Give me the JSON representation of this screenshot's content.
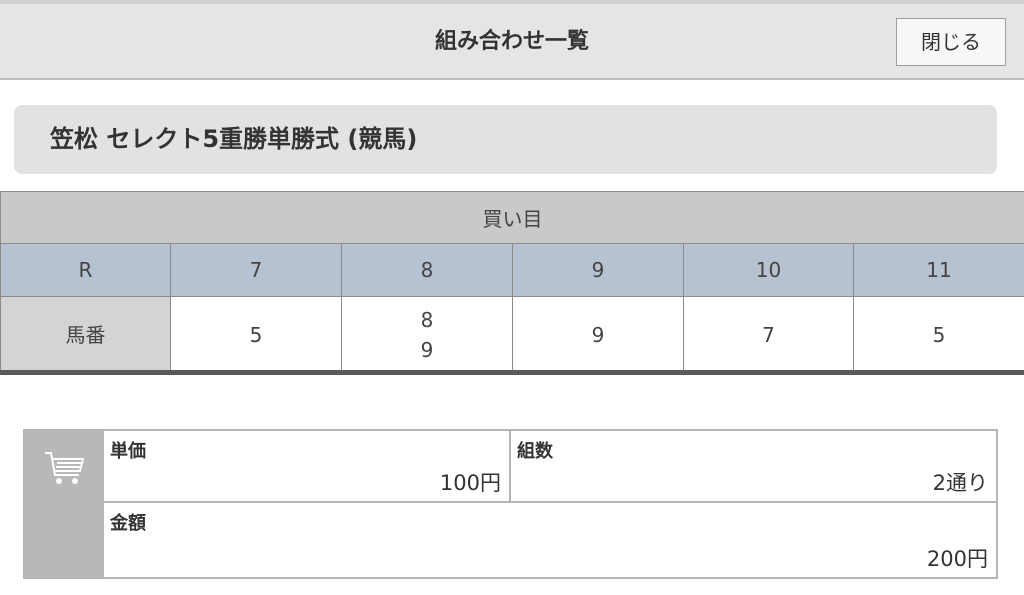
{
  "header": {
    "title": "組み合わせ一覧",
    "close_label": "閉じる"
  },
  "race": {
    "title": "笠松 セレクト5重勝単勝式 (競馬)"
  },
  "bets_table": {
    "heading": "買い目",
    "row_label_race": "R",
    "row_label_horse": "馬番",
    "races": [
      "7",
      "8",
      "9",
      "10",
      "11"
    ],
    "horses": [
      [
        "5"
      ],
      [
        "8",
        "9"
      ],
      [
        "9"
      ],
      [
        "7"
      ],
      [
        "5"
      ]
    ]
  },
  "summary": {
    "unit_price_label": "単価",
    "unit_price_value": "100円",
    "combinations_label": "組数",
    "combinations_value": "2通り",
    "amount_label": "金額",
    "amount_value": "200円",
    "icon": "cart-icon"
  },
  "colors": {
    "header_bg": "#e5e5e5",
    "race_row_bg": "#b6c2d1",
    "table_head_bg": "#c9c9c9",
    "cart_col_bg": "#b8b8b8"
  }
}
